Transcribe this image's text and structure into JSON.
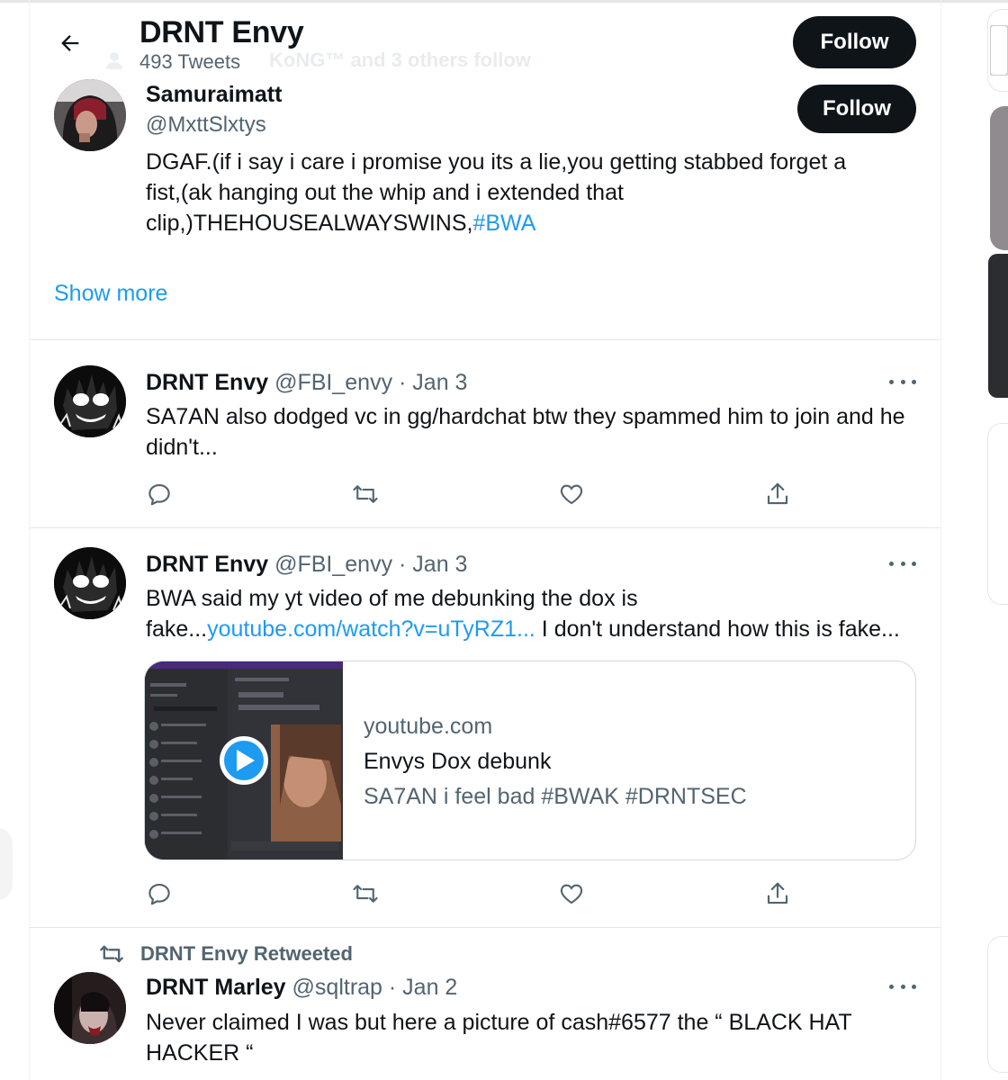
{
  "header": {
    "title": "DRNT Envy",
    "tweet_count": "493 Tweets",
    "ghost_text": "KoNG™ and 3 others follow",
    "follow_label": "Follow"
  },
  "user_card": {
    "name": "Samuraimatt",
    "handle": "@MxttSlxtys",
    "follow_label": "Follow",
    "bio_text": "DGAF.(if i say i care i promise you its a lie,you getting stabbed forget a fist,(ak hanging out the whip and i extended that clip,)THEHOUSEALWAYSWINS,",
    "bio_hashtag": "#BWA",
    "show_more": "Show more"
  },
  "tweets": [
    {
      "name": "DRNT Envy",
      "meta": "@FBI_envy · Jan 3",
      "text": "SA7AN also dodged vc in gg/hardchat btw they spammed him to join and he didn't..."
    },
    {
      "name": "DRNT Envy",
      "meta": "@FBI_envy · Jan 3",
      "text_before": "BWA said my yt video of me debunking the dox is fake...",
      "link": "youtube.com/watch?v=uTyRZ1...",
      "text_after": " I don't understand how this is fake...",
      "card": {
        "domain": "youtube.com",
        "title": "Envys Dox debunk",
        "description": "SA7AN i feel bad #BWAK #DRNTSEC"
      }
    },
    {
      "retweeted_by": "DRNT Envy Retweeted",
      "name": "DRNT Marley",
      "meta": "@sqltrap · Jan 2",
      "text": "Never claimed I was but here a picture of cash#6577 the “ BLACK HAT HACKER “"
    }
  ],
  "icons": {
    "back": "arrow-left-icon",
    "reply": "reply-icon",
    "retweet": "retweet-icon",
    "like": "heart-icon",
    "share": "share-icon",
    "more": "more-icon",
    "play": "play-icon"
  },
  "colors": {
    "accent": "#1d9bf0",
    "text": "#0f1419",
    "muted": "#536471",
    "button": "#0f1419"
  }
}
